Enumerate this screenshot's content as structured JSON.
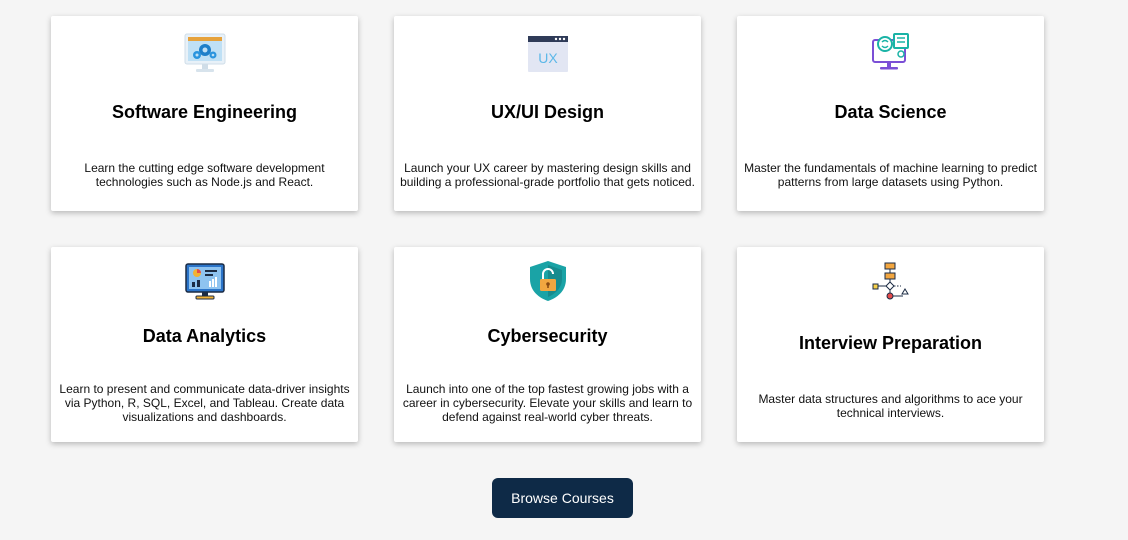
{
  "courses": [
    {
      "title": "Software Engineering",
      "description": "Learn the cutting edge software development technologies such as Node.js and React.",
      "icon": "monitor-gears-icon"
    },
    {
      "title": "UX/UI Design",
      "description": "Launch your UX career by mastering design skills and building a professional-grade portfolio that gets noticed.",
      "icon": "ux-window-icon",
      "icon_text": "UX"
    },
    {
      "title": "Data Science",
      "description": "Master the fundamentals of machine learning to predict patterns from large datasets using Python.",
      "icon": "brain-computer-icon"
    },
    {
      "title": "Data Analytics",
      "description": "Learn to present and communicate data-driver insights via Python, R, SQL, Excel, and Tableau. Create data visualizations and dashboards.",
      "icon": "analytics-dashboard-icon"
    },
    {
      "title": "Cybersecurity",
      "description": "Launch into one of the top fastest growing jobs with a career in cybersecurity. Elevate your skills and learn to defend against real-world cyber threats.",
      "icon": "shield-lock-icon"
    },
    {
      "title": "Interview Preparation",
      "description": "Master data structures and algorithms to ace your technical interviews.",
      "icon": "flowchart-icon"
    }
  ],
  "browse_button": {
    "label": "Browse Courses"
  },
  "colors": {
    "background": "#f5f5f5",
    "card": "#ffffff",
    "button": "#0e2a47",
    "button_text": "#ffffff"
  }
}
